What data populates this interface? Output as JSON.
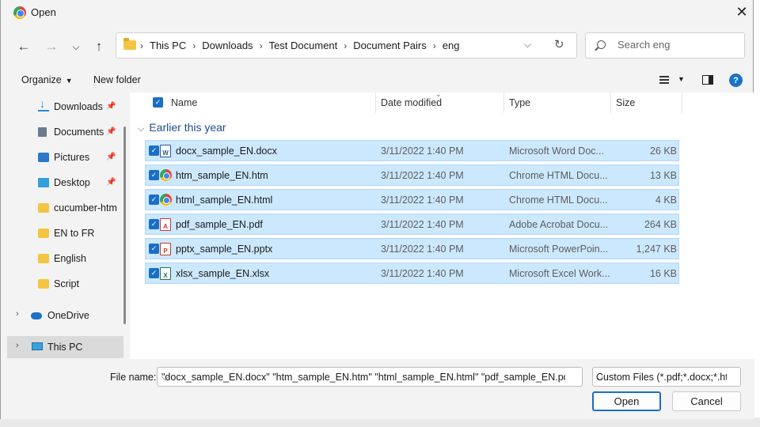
{
  "window": {
    "title": "Open"
  },
  "nav": {
    "breadcrumbs": [
      "This PC",
      "Downloads",
      "Test Document",
      "Document Pairs",
      "eng"
    ],
    "search_placeholder": "Search eng"
  },
  "commands": {
    "organize": "Organize",
    "new_folder": "New folder"
  },
  "sidebar": {
    "items": [
      {
        "label": "Downloads",
        "icon": "download-icon",
        "pinned": true
      },
      {
        "label": "Documents",
        "icon": "documents-icon",
        "pinned": true
      },
      {
        "label": "Pictures",
        "icon": "pictures-icon",
        "pinned": true
      },
      {
        "label": "Desktop",
        "icon": "desktop-icon",
        "pinned": true
      },
      {
        "label": "cucumber-htm",
        "icon": "folder-icon",
        "pinned": false
      },
      {
        "label": "EN to FR",
        "icon": "folder-icon",
        "pinned": false
      },
      {
        "label": "English",
        "icon": "folder-icon",
        "pinned": false
      },
      {
        "label": "Script",
        "icon": "folder-icon",
        "pinned": false
      },
      {
        "label": "OneDrive",
        "icon": "onedrive-icon",
        "pinned": false
      },
      {
        "label": "This PC",
        "icon": "this-pc-icon",
        "pinned": false,
        "selected": true
      }
    ]
  },
  "columns": {
    "name": "Name",
    "date": "Date modified",
    "type": "Type",
    "size": "Size"
  },
  "group": {
    "label": "Earlier this year"
  },
  "files": [
    {
      "name": "docx_sample_EN.docx",
      "date": "3/11/2022 1:40 PM",
      "type": "Microsoft Word Doc...",
      "size": "26 KB",
      "icon": "word"
    },
    {
      "name": "htm_sample_EN.htm",
      "date": "3/11/2022 1:40 PM",
      "type": "Chrome HTML Docu...",
      "size": "13 KB",
      "icon": "chrome"
    },
    {
      "name": "html_sample_EN.html",
      "date": "3/11/2022 1:40 PM",
      "type": "Chrome HTML Docu...",
      "size": "4 KB",
      "icon": "chrome"
    },
    {
      "name": "pdf_sample_EN.pdf",
      "date": "3/11/2022 1:40 PM",
      "type": "Adobe Acrobat Docu...",
      "size": "264 KB",
      "icon": "pdf"
    },
    {
      "name": "pptx_sample_EN.pptx",
      "date": "3/11/2022 1:40 PM",
      "type": "Microsoft PowerPoin...",
      "size": "1,247 KB",
      "icon": "ppt"
    },
    {
      "name": "xlsx_sample_EN.xlsx",
      "date": "3/11/2022 1:40 PM",
      "type": "Microsoft Excel Work...",
      "size": "16 KB",
      "icon": "xls"
    }
  ],
  "footer": {
    "file_name_label": "File name:",
    "file_name_value": "\"docx_sample_EN.docx\" \"htm_sample_EN.htm\" \"html_sample_EN.html\" \"pdf_sample_EN.pdf\" \"pp",
    "file_type_value": "Custom Files (*.pdf;*.docx;*.htm",
    "open_label": "Open",
    "cancel_label": "Cancel"
  }
}
